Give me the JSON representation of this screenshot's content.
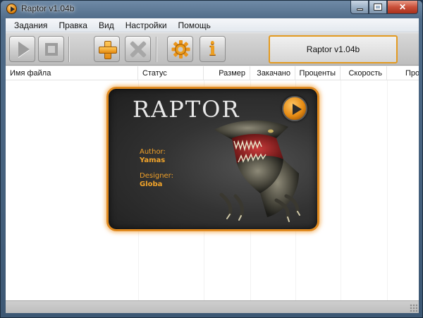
{
  "window": {
    "title": "Raptor v1.04b"
  },
  "menu": [
    "Задания",
    "Правка",
    "Вид",
    "Настройки",
    "Помощь"
  ],
  "toolbar": {
    "buttons": [
      {
        "icon": "play-icon"
      },
      {
        "icon": "stop-icon"
      },
      {
        "icon": "add-icon"
      },
      {
        "icon": "delete-icon"
      },
      {
        "icon": "gear-icon"
      },
      {
        "icon": "info-icon"
      }
    ],
    "version_label": "Raptor v1.04b"
  },
  "list": {
    "columns": [
      "Имя файла",
      "Статус",
      "Размер",
      "Закачано",
      "Проценты",
      "Скорость",
      "Про"
    ]
  },
  "about": {
    "title": "RAPTOR",
    "author_label": "Author:",
    "author": "Yamas",
    "designer_label": "Designer:",
    "designer": "Globa"
  },
  "colors": {
    "accent": "#e08a20",
    "credit_text": "#f0a028"
  }
}
